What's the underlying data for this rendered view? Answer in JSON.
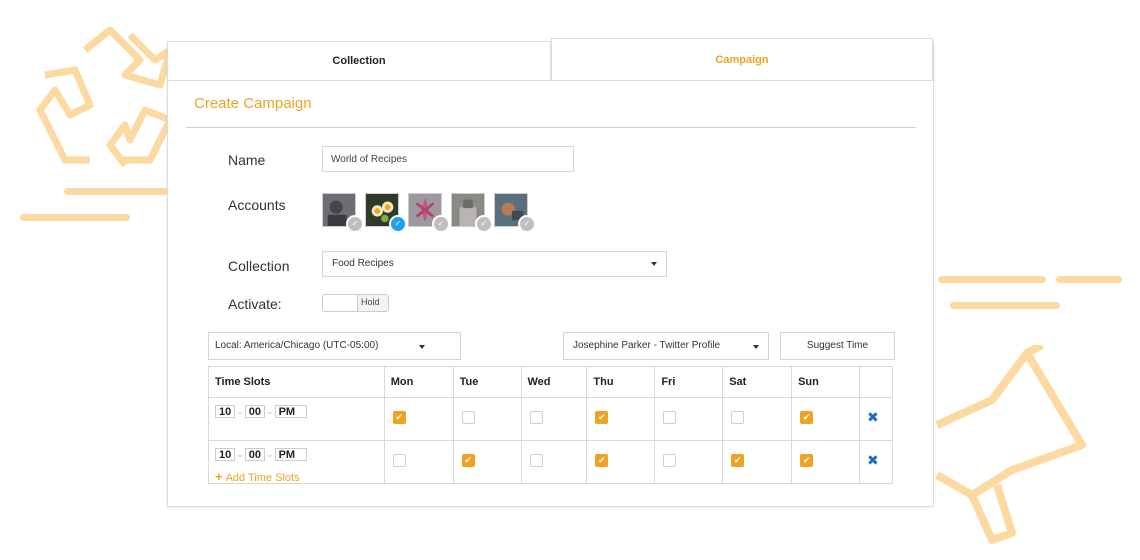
{
  "tabs": {
    "collection": "Collection",
    "campaign": "Campaign"
  },
  "page_title": "Create Campaign",
  "form": {
    "name_label": "Name",
    "name_value": "World of Recipes",
    "accounts_label": "Accounts",
    "collection_label": "Collection",
    "collection_value": "Food Recipes",
    "activate_label": "Activate:",
    "toggle_text": "Hold"
  },
  "accounts": [
    {
      "icon": "avatar-1",
      "selected": false
    },
    {
      "icon": "avatar-2",
      "selected": true
    },
    {
      "icon": "avatar-3",
      "selected": false
    },
    {
      "icon": "avatar-4",
      "selected": false
    },
    {
      "icon": "avatar-5",
      "selected": false
    }
  ],
  "scheduler": {
    "timezone": "Local: America/Chicago (UTC-05:00)",
    "profile": "Josephine Parker - Twitter Profile",
    "suggest_label": "Suggest Time",
    "columns": [
      "Time Slots",
      "Mon",
      "Tue",
      "Wed",
      "Thu",
      "Fri",
      "Sat",
      "Sun"
    ],
    "rows": [
      {
        "hour": "10",
        "minute": "00",
        "ampm": "PM",
        "days": [
          true,
          false,
          false,
          true,
          false,
          false,
          true
        ]
      },
      {
        "hour": "10",
        "minute": "00",
        "ampm": "PM",
        "days": [
          false,
          true,
          false,
          true,
          false,
          true,
          true
        ]
      }
    ],
    "add_label": "Add Time Slots"
  },
  "colors": {
    "accent": "#f0a224",
    "twitter": "#1da1f2",
    "remove": "#1f6fc0",
    "decor": "#fcd9a0"
  }
}
